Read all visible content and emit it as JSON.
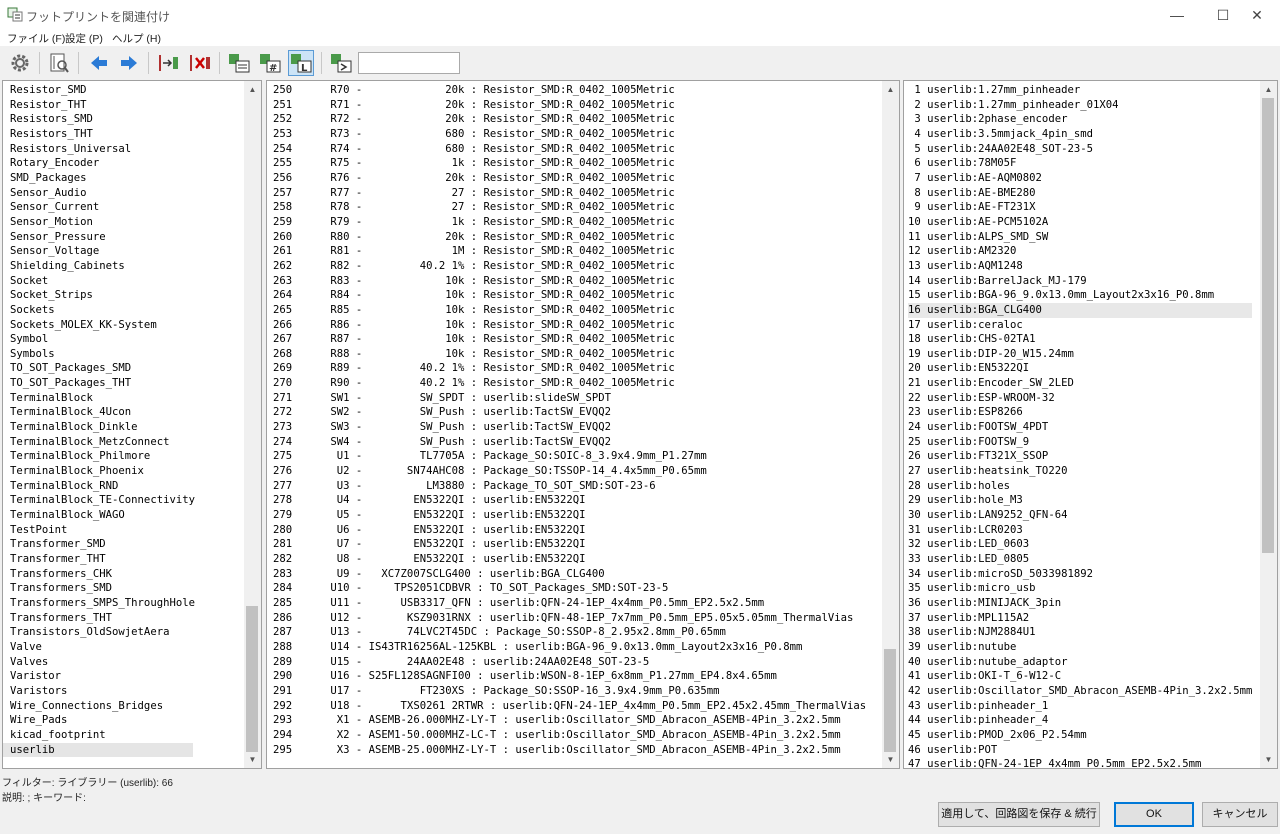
{
  "window": {
    "title": "フットプリントを関連付け",
    "min_glyph": "—",
    "max_glyph": "☐",
    "close_glyph": "✕"
  },
  "menu": [
    {
      "label": "ファイル (F)"
    },
    {
      "label": "設定 (P)"
    },
    {
      "label": "ヘルプ (H)"
    }
  ],
  "toolbar": {
    "icons": [
      "gear-icon",
      "library-browser-icon",
      "arrow-left-icon",
      "arrow-right-icon",
      "auto-associate-icon",
      "delete-association-icon",
      "filter-by-keyword-icon",
      "filter-by-pin-count-icon",
      "filter-by-library-icon",
      "filter-by-text-icon"
    ],
    "filter_value": "",
    "active": "filter-by-library-icon"
  },
  "libraries": [
    "Resistor_SMD",
    "Resistor_THT",
    "Resistors_SMD",
    "Resistors_THT",
    "Resistors_Universal",
    "Rotary_Encoder",
    "SMD_Packages",
    "Sensor_Audio",
    "Sensor_Current",
    "Sensor_Motion",
    "Sensor_Pressure",
    "Sensor_Voltage",
    "Shielding_Cabinets",
    "Socket",
    "Socket_Strips",
    "Sockets",
    "Sockets_MOLEX_KK-System",
    "Symbol",
    "Symbols",
    "TO_SOT_Packages_SMD",
    "TO_SOT_Packages_THT",
    "TerminalBlock",
    "TerminalBlock_4Ucon",
    "TerminalBlock_Dinkle",
    "TerminalBlock_MetzConnect",
    "TerminalBlock_Philmore",
    "TerminalBlock_Phoenix",
    "TerminalBlock_RND",
    "TerminalBlock_TE-Connectivity",
    "TerminalBlock_WAGO",
    "TestPoint",
    "Transformer_SMD",
    "Transformer_THT",
    "Transformers_CHK",
    "Transformers_SMD",
    "Transformers_SMPS_ThroughHole",
    "Transformers_THT",
    "Transistors_OldSowjetAera",
    "Valve",
    "Valves",
    "Varistor",
    "Varistors",
    "Wire_Connections_Bridges",
    "Wire_Pads",
    "kicad_footprint",
    "userlib"
  ],
  "selected_library": "userlib",
  "components": [
    "250      R70 -             20k : Resistor_SMD:R_0402_1005Metric",
    "251      R71 -             20k : Resistor_SMD:R_0402_1005Metric",
    "252      R72 -             20k : Resistor_SMD:R_0402_1005Metric",
    "253      R73 -             680 : Resistor_SMD:R_0402_1005Metric",
    "254      R74 -             680 : Resistor_SMD:R_0402_1005Metric",
    "255      R75 -              1k : Resistor_SMD:R_0402_1005Metric",
    "256      R76 -             20k : Resistor_SMD:R_0402_1005Metric",
    "257      R77 -              27 : Resistor_SMD:R_0402_1005Metric",
    "258      R78 -              27 : Resistor_SMD:R_0402_1005Metric",
    "259      R79 -              1k : Resistor_SMD:R_0402_1005Metric",
    "260      R80 -             20k : Resistor_SMD:R_0402_1005Metric",
    "261      R81 -              1M : Resistor_SMD:R_0402_1005Metric",
    "262      R82 -         40.2 1% : Resistor_SMD:R_0402_1005Metric",
    "263      R83 -             10k : Resistor_SMD:R_0402_1005Metric",
    "264      R84 -             10k : Resistor_SMD:R_0402_1005Metric",
    "265      R85 -             10k : Resistor_SMD:R_0402_1005Metric",
    "266      R86 -             10k : Resistor_SMD:R_0402_1005Metric",
    "267      R87 -             10k : Resistor_SMD:R_0402_1005Metric",
    "268      R88 -             10k : Resistor_SMD:R_0402_1005Metric",
    "269      R89 -         40.2 1% : Resistor_SMD:R_0402_1005Metric",
    "270      R90 -         40.2 1% : Resistor_SMD:R_0402_1005Metric",
    "271      SW1 -         SW_SPDT : userlib:slideSW_SPDT",
    "272      SW2 -         SW_Push : userlib:TactSW_EVQQ2",
    "273      SW3 -         SW_Push : userlib:TactSW_EVQQ2",
    "274      SW4 -         SW_Push : userlib:TactSW_EVQQ2",
    "275       U1 -         TL7705A : Package_SO:SOIC-8_3.9x4.9mm_P1.27mm",
    "276       U2 -       SN74AHC08 : Package_SO:TSSOP-14_4.4x5mm_P0.65mm",
    "277       U3 -          LM3880 : Package_TO_SOT_SMD:SOT-23-6",
    "278       U4 -        EN5322QI : userlib:EN5322QI",
    "279       U5 -        EN5322QI : userlib:EN5322QI",
    "280       U6 -        EN5322QI : userlib:EN5322QI",
    "281       U7 -        EN5322QI : userlib:EN5322QI",
    "282       U8 -        EN5322QI : userlib:EN5322QI",
    "283       U9 -   XC7Z007SCLG400 : userlib:BGA_CLG400",
    "284      U10 -     TPS2051CDBVR : TO_SOT_Packages_SMD:SOT-23-5",
    "285      U11 -      USB3317_QFN : userlib:QFN-24-1EP_4x4mm_P0.5mm_EP2.5x2.5mm",
    "286      U12 -       KSZ9031RNX : userlib:QFN-48-1EP_7x7mm_P0.5mm_EP5.05x5.05mm_ThermalVias",
    "287      U13 -       74LVC2T45DC : Package_SO:SSOP-8_2.95x2.8mm_P0.65mm",
    "288      U14 - IS43TR16256AL-125KBL : userlib:BGA-96_9.0x13.0mm_Layout2x3x16_P0.8mm",
    "289      U15 -       24AA02E48 : userlib:24AA02E48_SOT-23-5",
    "290      U16 - S25FL128SAGNFI00 : userlib:WSON-8-1EP_6x8mm_P1.27mm_EP4.8x4.65mm",
    "291      U17 -         FT230XS : Package_SO:SSOP-16_3.9x4.9mm_P0.635mm",
    "292      U18 -      TXS0261 2RTWR : userlib:QFN-24-1EP_4x4mm_P0.5mm_EP2.45x2.45mm_ThermalVias",
    "293       X1 - ASEMB-26.000MHZ-LY-T : userlib:Oscillator_SMD_Abracon_ASEMB-4Pin_3.2x2.5mm",
    "294       X2 - ASEM1-50.000MHZ-LC-T : userlib:Oscillator_SMD_Abracon_ASEMB-4Pin_3.2x2.5mm",
    "295       X3 - ASEMB-25.000MHZ-LY-T : userlib:Oscillator_SMD_Abracon_ASEMB-4Pin_3.2x2.5mm"
  ],
  "footprints": [
    " 1 userlib:1.27mm_pinheader",
    " 2 userlib:1.27mm_pinheader_01X04",
    " 3 userlib:2phase_encoder",
    " 4 userlib:3.5mmjack_4pin_smd",
    " 5 userlib:24AA02E48_SOT-23-5",
    " 6 userlib:78M05F",
    " 7 userlib:AE-AQM0802",
    " 8 userlib:AE-BME280",
    " 9 userlib:AE-FT231X",
    "10 userlib:AE-PCM5102A",
    "11 userlib:ALPS_SMD_SW",
    "12 userlib:AM2320",
    "13 userlib:AQM1248",
    "14 userlib:BarrelJack_MJ-179",
    "15 userlib:BGA-96_9.0x13.0mm_Layout2x3x16_P0.8mm",
    "16 userlib:BGA_CLG400",
    "17 userlib:ceraloc",
    "18 userlib:CHS-02TA1",
    "19 userlib:DIP-20_W15.24mm",
    "20 userlib:EN5322QI",
    "21 userlib:Encoder_SW_2LED",
    "22 userlib:ESP-WROOM-32",
    "23 userlib:ESP8266",
    "24 userlib:FOOTSW_4PDT",
    "25 userlib:FOOTSW_9",
    "26 userlib:FT321X_SSOP",
    "27 userlib:heatsink_TO220",
    "28 userlib:holes",
    "29 userlib:hole_M3",
    "30 userlib:LAN9252_QFN-64",
    "31 userlib:LCR0203",
    "32 userlib:LED_0603",
    "33 userlib:LED_0805",
    "34 userlib:microSD_5033981892",
    "35 userlib:micro_usb",
    "36 userlib:MINIJACK_3pin",
    "37 userlib:MPL115A2",
    "38 userlib:NJM2884U1",
    "39 userlib:nutube",
    "40 userlib:nutube_adaptor",
    "41 userlib:OKI-T_6-W12-C",
    "42 userlib:Oscillator_SMD_Abracon_ASEMB-4Pin_3.2x2.5mm",
    "43 userlib:pinheader_1",
    "44 userlib:pinheader_4",
    "45 userlib:PMOD_2x06_P2.54mm",
    "46 userlib:POT",
    "47 userlib:QFN-24-1EP_4x4mm_P0.5mm_EP2.5x2.5mm"
  ],
  "selected_footprint_index": 15,
  "status": {
    "filter": "フィルター: ライブラリー (userlib): 66",
    "description": "説明: ; キーワード:"
  },
  "buttons": {
    "apply": "適用して、回路図を保存 & 続行",
    "ok": "OK",
    "cancel": "キャンセル"
  }
}
